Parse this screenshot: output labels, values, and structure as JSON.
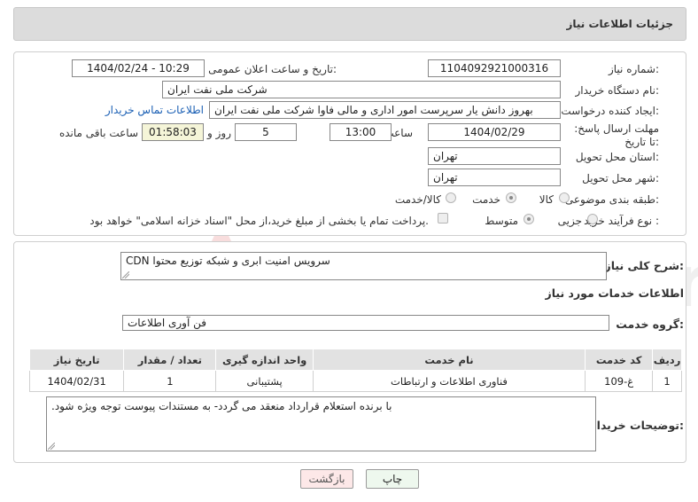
{
  "header": {
    "title": "جزئیات اطلاعات نیاز"
  },
  "fields": {
    "need_number_label": "شماره نیاز:",
    "need_number": "1104092921000316",
    "announce_label": "تاریخ و ساعت اعلان عمومی:",
    "announce_value": "1404/02/24 - 10:29",
    "buyer_org_label": "نام دستگاه خریدار:",
    "buyer_org": "شرکت ملی نفت ایران",
    "creator_label": "ایجاد کننده درخواست:",
    "creator": "بهروز دانش یار سرپرست امور اداری و مالی فاوا شرکت ملی نفت ایران",
    "contact_link": "اطلاعات تماس خریدار",
    "deadline_label": "مهلت ارسال پاسخ: تا تاریخ:",
    "deadline_date": "1404/02/29",
    "time_label": "ساعت",
    "deadline_time": "13:00",
    "days_value": "5",
    "days_label": "روز و",
    "remaining_time": "01:58:03",
    "remaining_label": "ساعت باقی مانده",
    "province_label": "استان محل تحویل:",
    "province": "تهران",
    "city_label": "شهر محل تحویل:",
    "city": "تهران",
    "category_label": "طبقه بندی موضوعی:",
    "category_options": [
      "کالا",
      "خدمت",
      "کالا/خدمت"
    ],
    "category_selected": "خدمت",
    "process_label": "نوع فرآیند خرید :",
    "process_options": [
      "جزیی",
      "متوسط"
    ],
    "process_selected": "متوسط",
    "payment_note": "پرداخت تمام یا بخشی از مبلغ خرید،از محل \"اسناد خزانه اسلامی\" خواهد بود."
  },
  "summary": {
    "label": "شرح کلی نیاز:",
    "value": "سرویس امنیت ابری و شبکه توزیع محتوا CDN"
  },
  "services": {
    "section_title": "اطلاعات خدمات مورد نیاز",
    "group_label": "گروه خدمت:",
    "group_value": "فن آوری اطلاعات",
    "columns": [
      "ردیف",
      "کد خدمت",
      "نام خدمت",
      "واحد اندازه گیری",
      "تعداد / مقدار",
      "تاریخ نیاز"
    ],
    "rows": [
      [
        "1",
        "غ-109",
        "فناوری اطلاعات و ارتباطات",
        "پشتیبانی",
        "1",
        "1404/02/31"
      ]
    ]
  },
  "buyer_notes": {
    "label": "توضیحات خریدار:",
    "value": "با برنده استعلام قرارداد منعقد می گردد- به مستندات پیوست توجه ویژه شود."
  },
  "buttons": {
    "print": "چاپ",
    "back": "بازگشت"
  },
  "colors": {
    "link": "#1a5fb4",
    "back_button_bg": "#fde8e8",
    "print_button_bg": "#eef8ee",
    "table_header_bg": "#e2e2e2"
  }
}
